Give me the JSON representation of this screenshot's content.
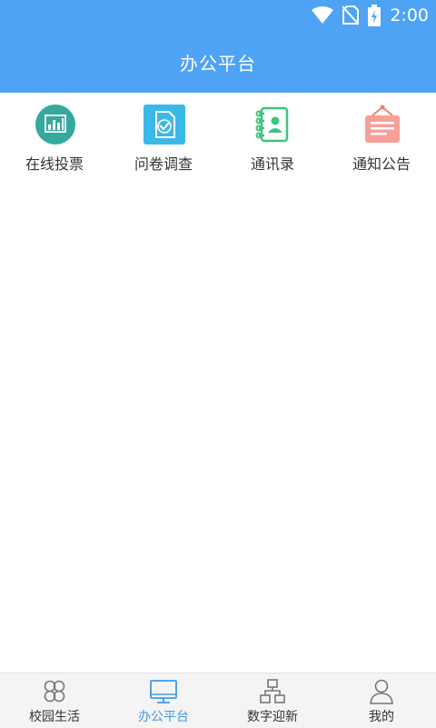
{
  "status_bar": {
    "time": "2:00",
    "icons": [
      "wifi-icon",
      "no-sim-icon",
      "battery-charging-icon"
    ]
  },
  "header": {
    "title": "办公平台",
    "background_color": "#4ea3f5"
  },
  "grid": {
    "items": [
      {
        "label": "在线投票",
        "icon": "bar-chart-icon",
        "color": "#35a99d"
      },
      {
        "label": "问卷调查",
        "icon": "survey-doc-icon",
        "color": "#3ab9e8"
      },
      {
        "label": "通讯录",
        "icon": "contacts-book-icon",
        "color": "#3fc47d"
      },
      {
        "label": "通知公告",
        "icon": "notice-board-icon",
        "color": "#f47c73"
      }
    ]
  },
  "tabbar": {
    "active_color": "#3f9ae8",
    "tabs": [
      {
        "label": "校园生活",
        "icon": "flower-grid-icon",
        "active": false
      },
      {
        "label": "办公平台",
        "icon": "monitor-icon",
        "active": true
      },
      {
        "label": "数字迎新",
        "icon": "network-icon",
        "active": false
      },
      {
        "label": "我的",
        "icon": "person-icon",
        "active": false
      }
    ]
  }
}
